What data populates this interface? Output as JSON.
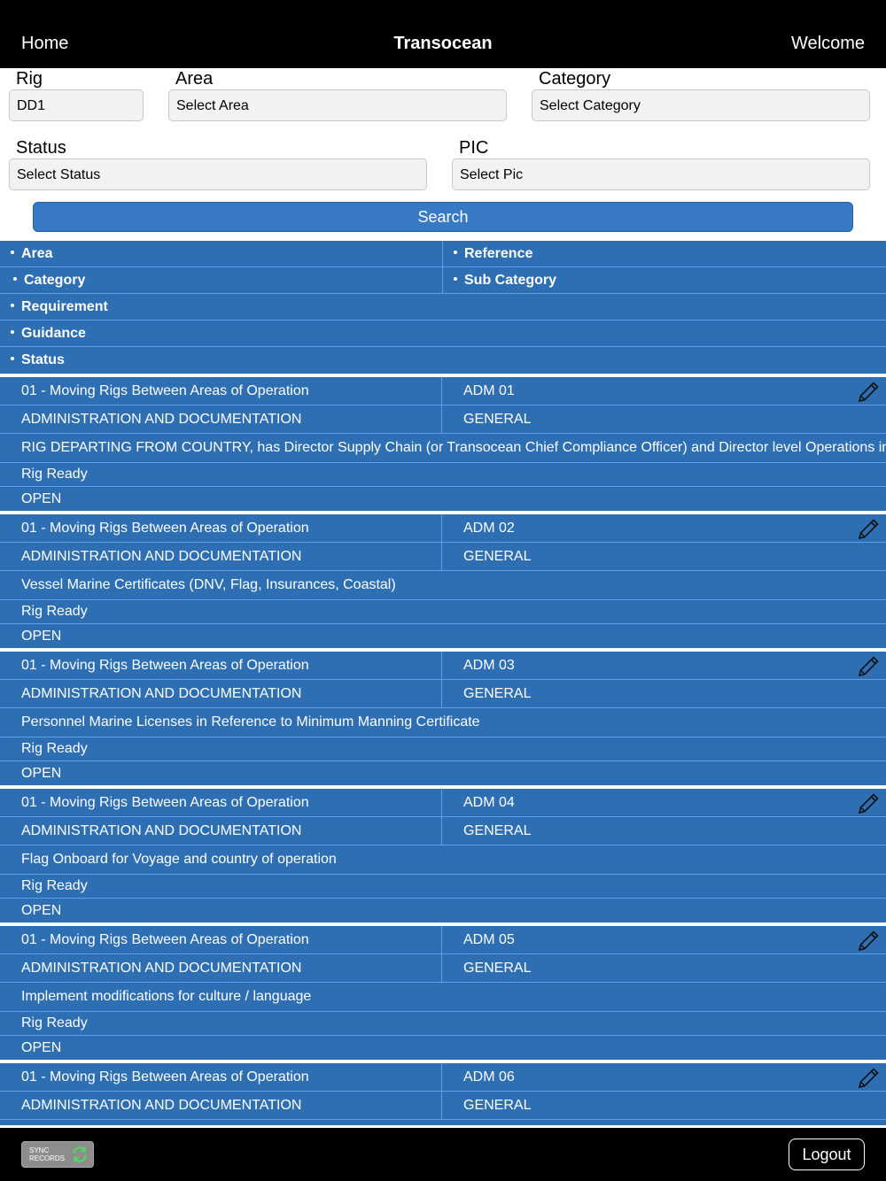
{
  "header": {
    "home": "Home",
    "title": "Transocean",
    "welcome": "Welcome"
  },
  "filters": {
    "rig": {
      "label": "Rig",
      "value": "DD1"
    },
    "area": {
      "label": "Area",
      "placeholder": "Select Area"
    },
    "category": {
      "label": "Category",
      "placeholder": "Select Category"
    },
    "status": {
      "label": "Status",
      "placeholder": "Select Status"
    },
    "pic": {
      "label": "PIC",
      "placeholder": "Select Pic"
    }
  },
  "search_label": "Search",
  "columns": {
    "area": "Area",
    "reference": "Reference",
    "category": "Category",
    "sub_category": "Sub Category",
    "requirement": "Requirement",
    "guidance": "Guidance",
    "status": "Status"
  },
  "records": [
    {
      "area": "01 - Moving Rigs Between Areas of Operation",
      "reference": "ADM 01",
      "category": "ADMINISTRATION AND DOCUMENTATION",
      "sub_category": "GENERAL",
      "requirement": "RIG DEPARTING FROM COUNTRY, has Director Supply Chain (or Transocean Chief Compliance Officer) and Director level Operations in",
      "guidance": "Rig Ready",
      "status": "OPEN"
    },
    {
      "area": "01 - Moving Rigs Between Areas of Operation",
      "reference": "ADM 02",
      "category": "ADMINISTRATION AND DOCUMENTATION",
      "sub_category": "GENERAL",
      "requirement": "Vessel  Marine Certificates (DNV, Flag, Insurances, Coastal)",
      "guidance": "Rig Ready",
      "status": "OPEN"
    },
    {
      "area": "01 - Moving Rigs Between Areas of Operation",
      "reference": "ADM 03",
      "category": "ADMINISTRATION AND DOCUMENTATION",
      "sub_category": "GENERAL",
      "requirement": "Personnel Marine Licenses in Reference to Minimum Manning Certificate",
      "guidance": "Rig Ready",
      "status": "OPEN"
    },
    {
      "area": "01 - Moving Rigs Between Areas of Operation",
      "reference": "ADM 04",
      "category": "ADMINISTRATION AND DOCUMENTATION",
      "sub_category": "GENERAL",
      "requirement": "Flag Onboard for Voyage and country of operation",
      "guidance": "Rig Ready",
      "status": "OPEN"
    },
    {
      "area": "01 - Moving Rigs Between Areas of Operation",
      "reference": "ADM 05",
      "category": "ADMINISTRATION AND DOCUMENTATION",
      "sub_category": "GENERAL",
      "requirement": "Implement modifications for culture / language",
      "guidance": "Rig Ready",
      "status": "OPEN"
    },
    {
      "area": "01 - Moving Rigs Between Areas of Operation",
      "reference": "ADM 06",
      "category": "ADMINISTRATION AND DOCUMENTATION",
      "sub_category": "GENERAL",
      "requirement": "",
      "guidance": "",
      "status": ""
    }
  ],
  "footer": {
    "sync_line1": "SYNC",
    "sync_line2": "RECORDS",
    "logout": "Logout"
  },
  "colors": {
    "topbar": "#000000",
    "grid": "#2e6fb3",
    "button": "#3779c4",
    "divider": "#5aa0ef"
  },
  "icons": {
    "edit": "pencil-icon",
    "sync": "sync-arrows-icon"
  }
}
